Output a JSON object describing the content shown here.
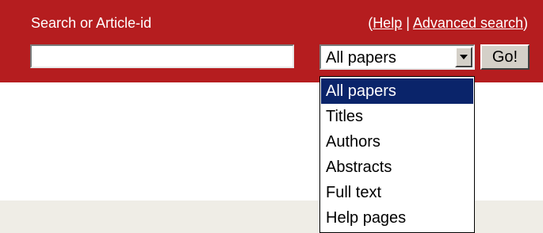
{
  "search_bar": {
    "label": "Search or Article-id",
    "help_prefix": "(",
    "help_link": "Help",
    "separator": " | ",
    "advanced_link": "Advanced search",
    "help_suffix": ")",
    "input_value": "",
    "go_label": "Go!"
  },
  "select": {
    "selected_value": "All papers",
    "options": [
      "All papers",
      "Titles",
      "Authors",
      "Abstracts",
      "Full text",
      "Help pages"
    ],
    "highlighted_index": 0
  },
  "colors": {
    "bar": "#b51d1f",
    "highlight": "#0a246a",
    "button_face": "#d4d0c8",
    "strip": "#efede6",
    "corner": "#1a8a9c"
  }
}
